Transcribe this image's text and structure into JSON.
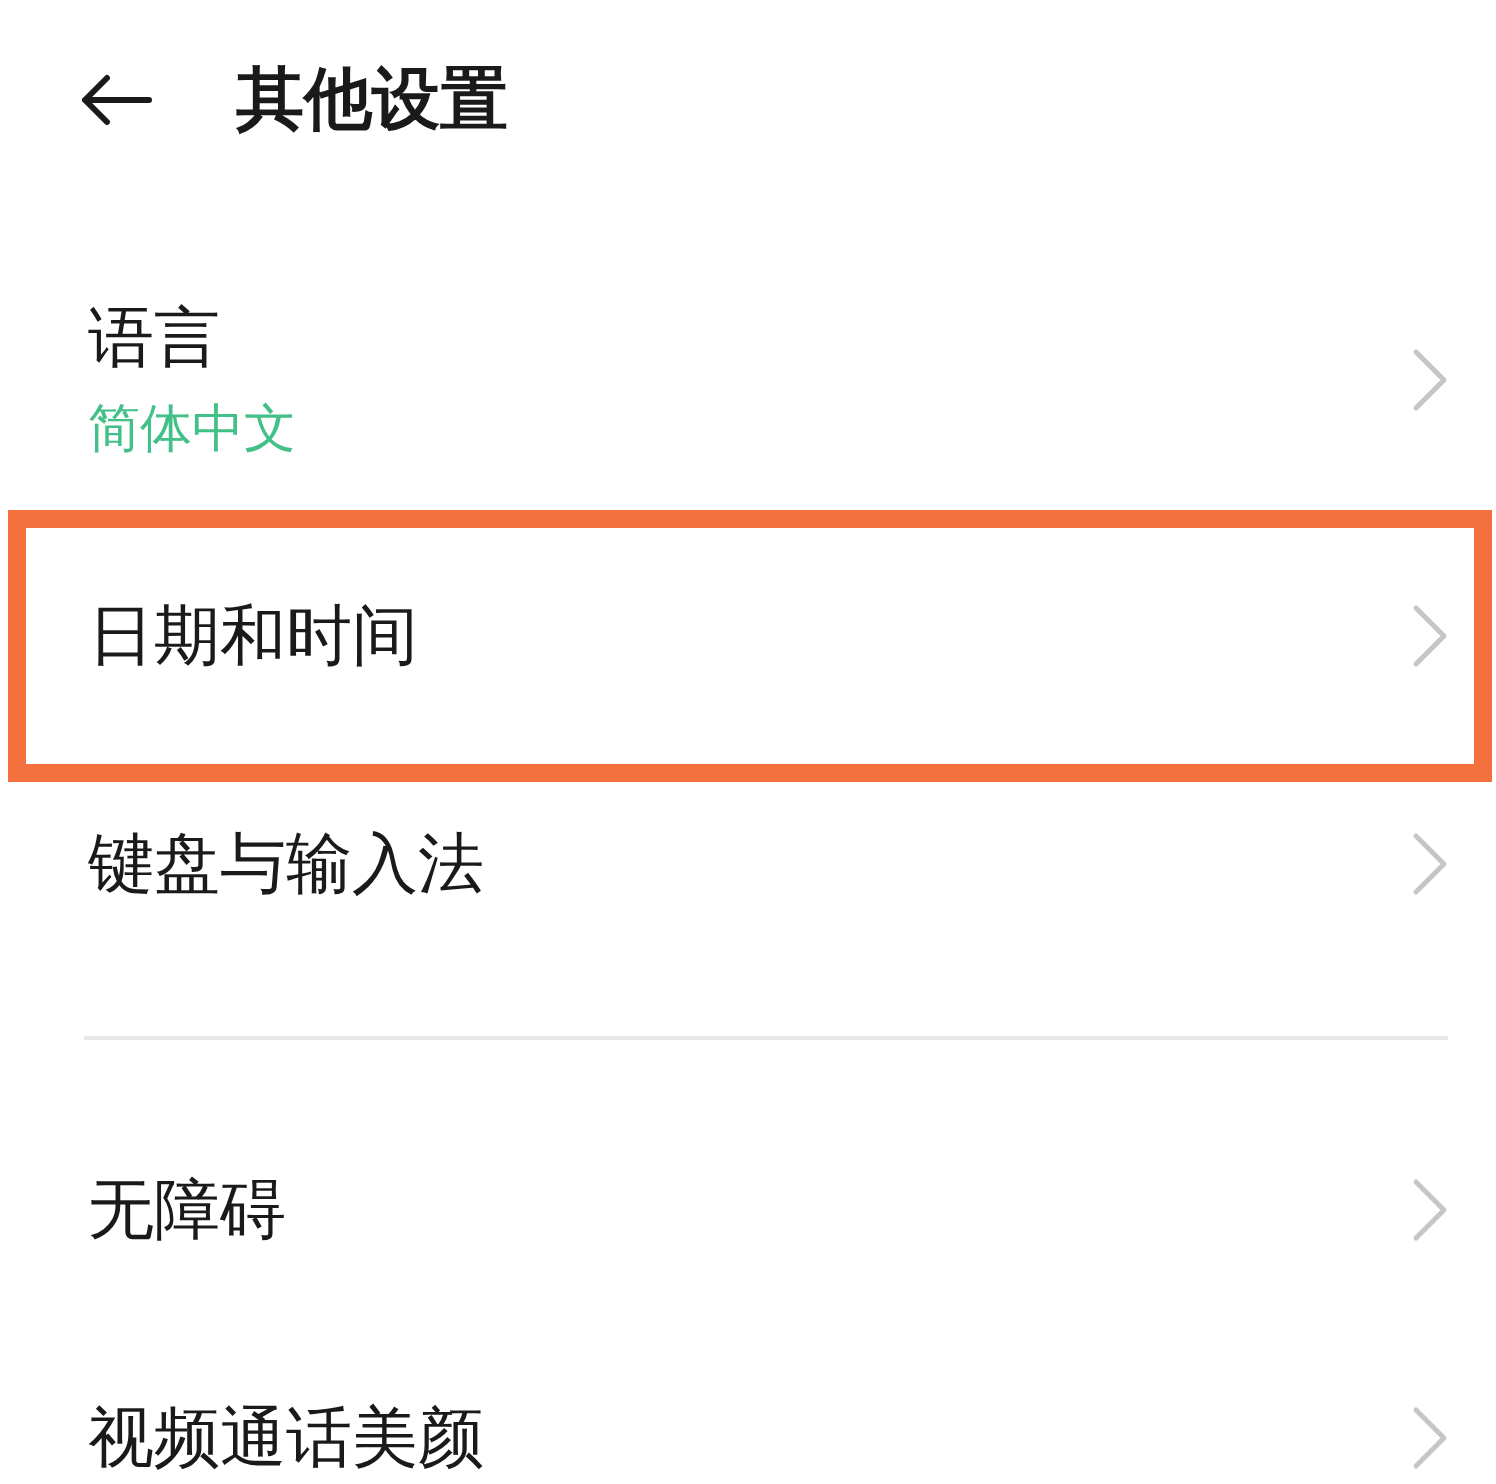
{
  "header": {
    "title": "其他设置"
  },
  "groups": [
    {
      "items": [
        {
          "label": "语言",
          "value": "简体中文",
          "highlighted": false
        },
        {
          "label": "日期和时间",
          "highlighted": true
        },
        {
          "label": "键盘与输入法",
          "highlighted": false
        }
      ]
    },
    {
      "items": [
        {
          "label": "无障碍",
          "highlighted": false
        },
        {
          "label": "视频通话美颜",
          "highlighted": false
        }
      ]
    }
  ]
}
